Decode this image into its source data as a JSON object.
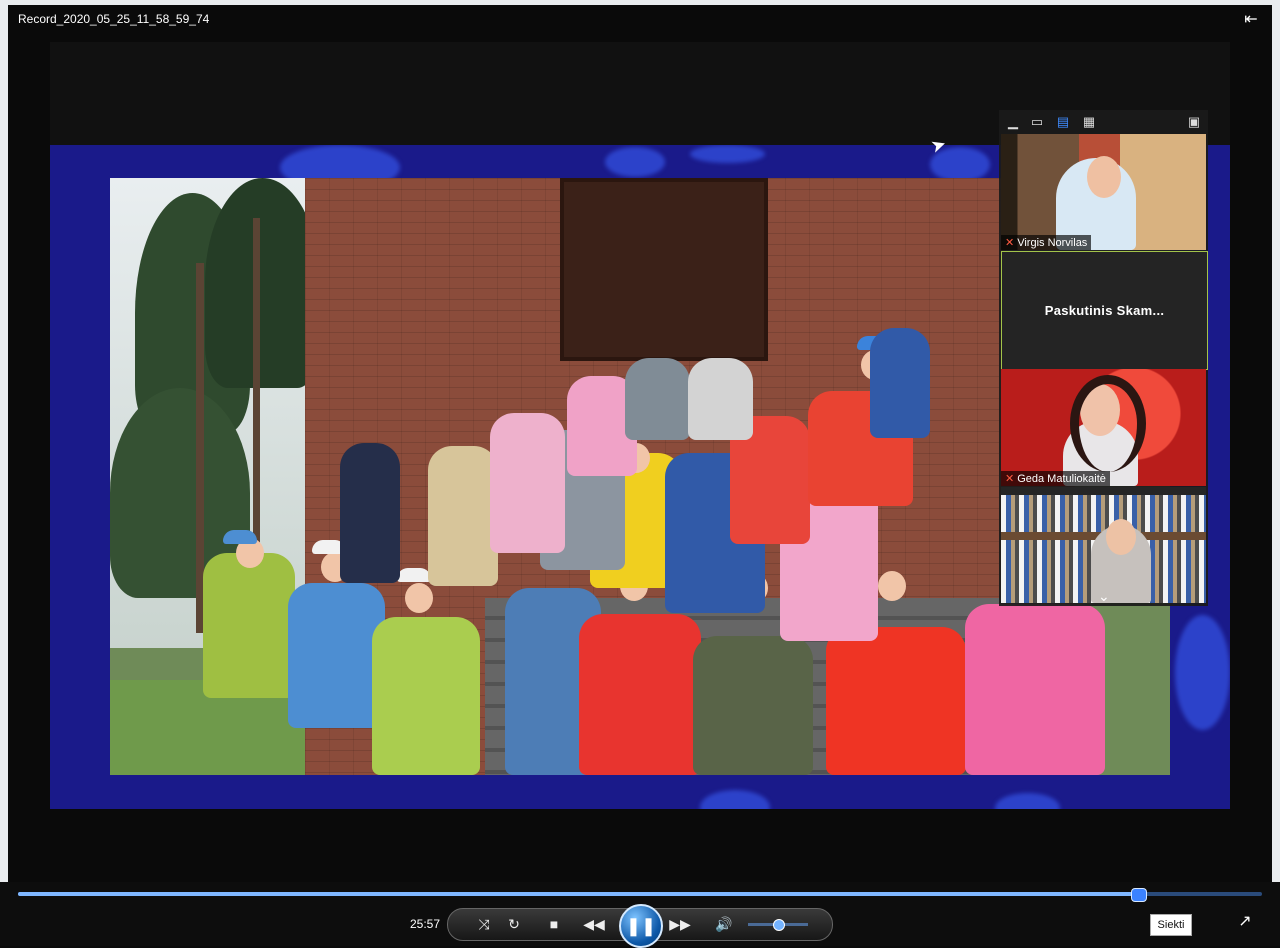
{
  "window": {
    "title": "Record_2020_05_25_11_58_59_74"
  },
  "participants": {
    "toolbar_icons": [
      "minimize-icon",
      "speaker-view-icon",
      "strip-view-icon",
      "gallery-view-icon",
      "popout-icon"
    ],
    "tiles": [
      {
        "name": "Virgis Norvilas",
        "muted": true
      },
      {
        "name": "Paskutinis  Skam..."
      },
      {
        "name": "Geda Matuliokaitė",
        "muted": true
      }
    ]
  },
  "player": {
    "time": "25:57",
    "progress": 0.9,
    "volume": 0.5,
    "seek_button": "Siekti"
  },
  "colors": {
    "accent": "#3b82ff",
    "zoom_background": "#1a1a8a"
  }
}
